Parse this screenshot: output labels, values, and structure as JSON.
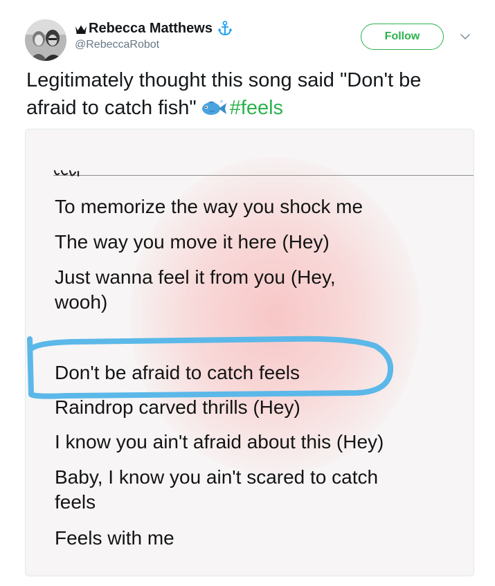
{
  "user": {
    "display_name": "Rebecca Matthews",
    "handle": "@RebeccaRobot",
    "crown_icon": "crown-icon",
    "badge_icon": "anchor-icon",
    "badge_color": "#1da1f2"
  },
  "actions": {
    "follow_label": "Follow",
    "accent_color": "#2bb24c",
    "menu_icon": "chevron-down-icon"
  },
  "tweet": {
    "text_line_1": "Legitimately thought this song said \"Don't be",
    "text_line_2": "afraid to catch fish\"",
    "emoji": "fish-icon",
    "hashtag": "#feels"
  },
  "media": {
    "lyrics": {
      "line_1": "To memorize the way you shock me",
      "line_2": "The way you move it here (Hey)",
      "line_3a": "Just wanna feel it from you (Hey,",
      "line_3b": "wooh)",
      "line_4": "Don't be afraid to catch feels",
      "line_5": "Raindrop carved thrills (Hey)",
      "line_6": "I know you ain't afraid about this (Hey)",
      "line_7a": "Baby, I know you ain't scared to catch",
      "line_7b": "feels",
      "line_8": "Feels with me"
    },
    "highlight_color": "#5bb8e8"
  }
}
